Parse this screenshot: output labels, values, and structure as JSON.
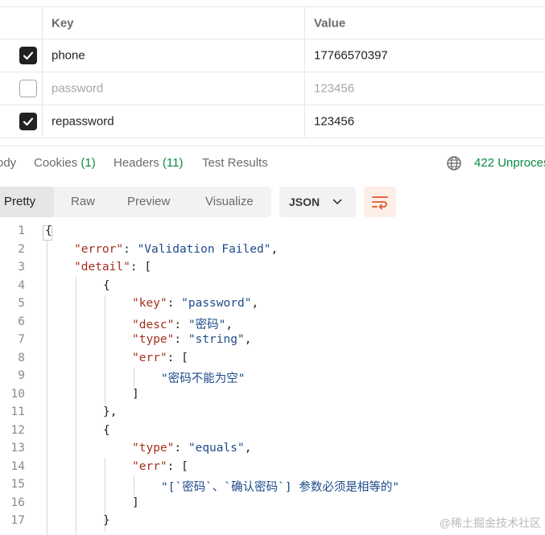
{
  "params": {
    "headers": {
      "key": "Key",
      "value": "Value"
    },
    "rows": [
      {
        "checked": true,
        "key": "phone",
        "value": "17766570397"
      },
      {
        "checked": false,
        "key": "password",
        "value": "123456"
      },
      {
        "checked": true,
        "key": "repassword",
        "value": "123456"
      }
    ]
  },
  "response_tabs": {
    "body": "ody",
    "cookies": "Cookies",
    "cookies_count": "(1)",
    "headers": "Headers",
    "headers_count": "(11)",
    "test_results": "Test Results",
    "status": "422 Unproces"
  },
  "toolbar": {
    "pretty": "Pretty",
    "raw": "Raw",
    "preview": "Preview",
    "visualize": "Visualize",
    "format": "JSON"
  },
  "code": {
    "line_numbers": [
      "1",
      "2",
      "3",
      "4",
      "5",
      "6",
      "7",
      "8",
      "9",
      "10",
      "11",
      "12",
      "13",
      "14",
      "15",
      "16",
      "17"
    ],
    "l1_open": "{",
    "l2_key": "\"error\"",
    "l2_val": "\"Validation Failed\"",
    "l3_key": "\"detail\"",
    "l3_open": "[",
    "l4_open": "{",
    "l5_key": "\"key\"",
    "l5_val": "\"password\"",
    "l6_key": "\"desc\"",
    "l6_val": "\"密码\"",
    "l7_key": "\"type\"",
    "l7_val": "\"string\"",
    "l8_key": "\"err\"",
    "l8_open": "[",
    "l9_val": "\"密码不能为空\"",
    "l10_close": "]",
    "l11_close": "},",
    "l12_open": "{",
    "l13_key": "\"type\"",
    "l13_val": "\"equals\"",
    "l14_key": "\"err\"",
    "l14_open": "[",
    "l15_val": "\"[`密码`、`确认密码`] 参数必须是相等的\"",
    "l16_close": "]",
    "l17_close": "}"
  },
  "watermark": "@稀土掘金技术社区"
}
